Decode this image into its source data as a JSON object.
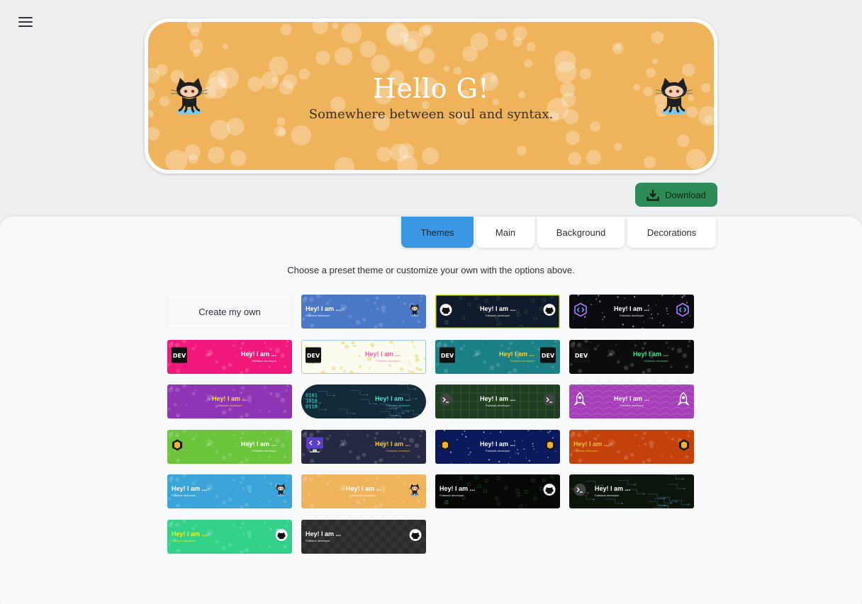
{
  "menu": {
    "icon": "hamburger-menu-icon"
  },
  "banner": {
    "title": "Hello G!",
    "subtitle": "Somewhere between soul and syntax.",
    "background_color": "#efb35b",
    "decoration_icons": [
      "octocat-icon",
      "octocat-icon"
    ]
  },
  "download": {
    "label": "Download",
    "icon": "download-icon",
    "color": "#2e8b57"
  },
  "tabs": [
    {
      "label": "Themes",
      "active": true
    },
    {
      "label": "Main",
      "active": false
    },
    {
      "label": "Background",
      "active": false
    },
    {
      "label": "Decorations",
      "active": false
    }
  ],
  "hint": "Choose a preset theme or customize your own with the options above.",
  "themes": [
    {
      "label": "Create my own"
    },
    {
      "title": "Hey! I am ...",
      "subtitle": "Fullstack developer",
      "bg": "#4a78c7",
      "fg": "#ffffff",
      "icon": "octocat-icon",
      "style": "dots"
    },
    {
      "title": "Hey! I am ...",
      "subtitle": "Fullstack developer",
      "bg": "#101a2c",
      "fg": "#ffffff",
      "icon": "github-icon",
      "style": "doodle"
    },
    {
      "title": "Hey! I am ...",
      "subtitle": "Fullstack developer",
      "bg": "#0b0b12",
      "fg": "#ffffff",
      "icon": "code-hexagon-icon",
      "style": "stars"
    },
    {
      "title": "Hey! I am ...",
      "subtitle": "Fullstack developer",
      "bg": "#f0187a",
      "fg": "#ffffff",
      "icon": "dev-logo-icon",
      "style": "dots"
    },
    {
      "title": "Hey! I am ...",
      "subtitle": "Fullstack developer",
      "bg": "#fbfbf0",
      "fg": "#f06aa8",
      "icon": "dev-logo-icon",
      "style": "confetti"
    },
    {
      "title": "Hey! I am ...",
      "subtitle": "Fullstack developer",
      "bg": "#1a7f86",
      "fg": "#f5d12a",
      "icon": "dev-logo-icon",
      "style": "dots"
    },
    {
      "title": "Hey! I am ...",
      "subtitle": "Fullstack developer",
      "bg": "#0c0c0c",
      "fg": "#3ee08f",
      "icon": "dev-logo-icon",
      "style": "dots"
    },
    {
      "title": "Hey! I am ...",
      "subtitle": "Fullstack developer",
      "bg": "#8e35b5",
      "fg": "#f5e04c",
      "icon": "",
      "style": "dots"
    },
    {
      "title": "Hey! I am ...",
      "subtitle": "Fullstack developer",
      "bg": "#102a3a",
      "fg": "#4ee3d1",
      "icon": "binary-icon",
      "style": "circuit"
    },
    {
      "title": "Hey! I am ...",
      "subtitle": "Fullstack developer",
      "bg": "#1f3d22",
      "fg": "#ffffff",
      "icon": "terminal-icon",
      "style": "grid"
    },
    {
      "title": "Hey! I am ...",
      "subtitle": "Fullstack developer",
      "bg": "#a540b8",
      "fg": "#ffffff",
      "icon": "rocket-icon",
      "style": "waves"
    },
    {
      "title": "Hey! I am ...",
      "subtitle": "Fullstack developer",
      "bg": "#6cc43c",
      "fg": "#ffffff",
      "icon": "cube-icon",
      "style": "dots"
    },
    {
      "title": "Hey! I am ...",
      "subtitle": "Fullstack developer",
      "bg": "#252842",
      "fg": "#f2c230",
      "icon": "monitor-code-icon",
      "style": "dots"
    },
    {
      "title": "Hey! I am ...",
      "subtitle": "Fullstack developer",
      "bg": "#0b1a5c",
      "fg": "#ffffff",
      "icon": "cube-icon",
      "style": "stars"
    },
    {
      "title": "Hey! I am ...",
      "subtitle": "Fullstack developer",
      "bg": "#c3420c",
      "fg": "#f2c230",
      "icon": "cube-icon",
      "style": "dots"
    },
    {
      "title": "Hey! I am ...",
      "subtitle": "Fullstack developer",
      "bg": "#3aa3d8",
      "fg": "#ffffff",
      "icon": "octocat-icon",
      "style": "dots"
    },
    {
      "title": "Hey! I am ...",
      "subtitle": "Fullstack developer",
      "bg": "#efb35b",
      "fg": "#ffffff",
      "icon": "octocat-icon",
      "style": "dots"
    },
    {
      "title": "Hey! I am ...",
      "subtitle": "Fullstack developer",
      "bg": "#050805",
      "fg": "#ffffff",
      "icon": "github-icon",
      "style": "doodle"
    },
    {
      "title": "Hey! I am ...",
      "subtitle": "Fullstack developer",
      "bg": "#0b150b",
      "fg": "#ffffff",
      "icon": "terminal-icon",
      "style": "circuit"
    },
    {
      "title": "Hey! I am ...",
      "subtitle": "Fullstack developer",
      "bg": "#33d08a",
      "fg": "#f2f21e",
      "icon": "github-icon",
      "style": "dots"
    },
    {
      "title": "Hey! I am ...",
      "subtitle": "Fullstack developer",
      "bg": "#2a2a2a",
      "fg": "#ffffff",
      "icon": "github-icon",
      "style": "checker"
    }
  ]
}
